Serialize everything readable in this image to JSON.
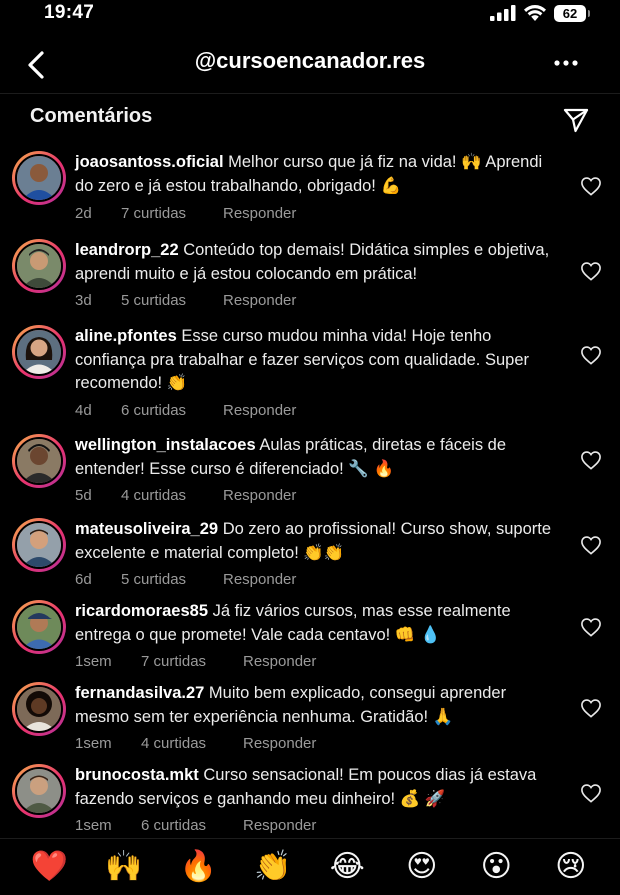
{
  "status": {
    "time": "19:47",
    "battery": "62"
  },
  "header": {
    "handle": "@cursoencanador.res"
  },
  "section": {
    "title": "Comentários"
  },
  "comments": [
    {
      "username": "joaosantoss.oficial",
      "text": "Melhor curso que já fiz na vida! 🙌 Aprendi do zero e já estou trabalhando, obrigado! 💪",
      "age": "2d",
      "likes": "7 curtidas",
      "reply": "Responder",
      "skin": "#8a5a3c",
      "shirt": "#1f4fa0"
    },
    {
      "username": "leandrorp_22",
      "text": "Conteúdo top demais! Didática simples e objetiva, aprendi muito e já estou colocando em prática!",
      "age": "3d",
      "likes": "5 curtidas",
      "reply": "Responder",
      "skin": "#c89a74",
      "shirt": "#3e4a3a"
    },
    {
      "username": "aline.pfontes",
      "text": "Esse curso mudou minha vida! Hoje tenho confiança pra trabalhar e fazer serviços com qualidade. Super recomendo! 👏",
      "age": "4d",
      "likes": "6 curtidas",
      "reply": "Responder",
      "skin": "#d7a584",
      "shirt": "#f0ede8"
    },
    {
      "username": "wellington_instalacoes",
      "text": "Aulas práticas, diretas e fáceis de entender! Esse curso é diferenciado! 🔧 🔥",
      "age": "5d",
      "likes": "4 curtidas",
      "reply": "Responder",
      "skin": "#6b4630",
      "shirt": "#2a2a2a"
    },
    {
      "username": "mateusoliveira_29",
      "text": "Do zero ao profissional! Curso show, suporte excelente e material completo! 👏👏",
      "age": "6d",
      "likes": "5 curtidas",
      "reply": "Responder",
      "skin": "#d3a07c",
      "shirt": "#2d4a6b"
    },
    {
      "username": "ricardomoraes85",
      "text": "Já fiz vários cursos, mas esse realmente entrega o que promete! Vale cada centavo! 👊 💧",
      "age": "1sem",
      "likes": "7 curtidas",
      "reply": "Responder",
      "skin": "#b07a56",
      "shirt": "#3d6bb0"
    },
    {
      "username": "fernandasilva.27",
      "text": "Muito bem explicado, consegui aprender mesmo sem ter experiência nenhuma. Gratidão! 🙏",
      "age": "1sem",
      "likes": "4 curtidas",
      "reply": "Responder",
      "skin": "#5e3a24",
      "shirt": "#e8e4dc"
    },
    {
      "username": "brunocosta.mkt",
      "text": "Curso sensacional! Em poucos dias já estava fazendo serviços e ganhando meu dinheiro! 💰 🚀",
      "age": "1sem",
      "likes": "6 curtidas",
      "reply": "Responder",
      "skin": "#caa07f",
      "shirt": "#4f5a44"
    }
  ],
  "emoji_bar": [
    "❤️",
    "🙌",
    "🔥",
    "👏",
    "😂",
    "😍",
    "😮",
    "😢"
  ]
}
